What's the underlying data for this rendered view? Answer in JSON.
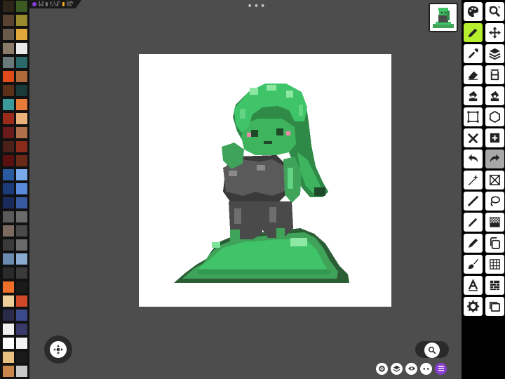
{
  "status": {
    "mem_line1": "4.0",
    "mem_line2": "99%",
    "cpu_line1": "ø 2.45",
    "cpu_line2": "12.5M",
    "bat_line1": "540%",
    "bat_line2": "25%"
  },
  "palette_colors": [
    "#2e2418",
    "#3c5a22",
    "#5a4232",
    "#9a8a2e",
    "#6a5a4a",
    "#e0a83a",
    "#8a7a6a",
    "#eaeaea",
    "#6a7a7a",
    "#2a6a6a",
    "#e04a1a",
    "#b06a3a",
    "#5a3018",
    "#1a3a3a",
    "#3a9a9a",
    "#e87a3a",
    "#9a2a1a",
    "#eab27a",
    "#6a1a1a",
    "#b0704a",
    "#4a2018",
    "#8a2a1a",
    "#5a1010",
    "#6a2a18",
    "#2a5aa0",
    "#7aaaea",
    "#1a3a7a",
    "#5a8ada",
    "#1a2a5a",
    "#3a5aa0",
    "#5a5a5a",
    "#6a6a6a",
    "#7a6a60",
    "#4a4a4a",
    "#3a3a3a",
    "#6a6a6a",
    "#6a8ab0",
    "#8aaad0",
    "#2a2a2a",
    "#3a3a3a",
    "#f0702a",
    "#1a1a1a",
    "#f0d09a",
    "#d04a2a",
    "#2a2a4a",
    "#3a4a8a",
    "#f0f0f0",
    "#3a3a6a",
    "#ffffff",
    "#f4f4f4",
    "#e8c080",
    "#1a1a1a",
    "#c8864a",
    "#c8c8c8"
  ],
  "tools": [
    {
      "name": "palette",
      "active": false
    },
    {
      "name": "zoom",
      "active": false
    },
    {
      "name": "pencil",
      "active": true
    },
    {
      "name": "move",
      "active": false
    },
    {
      "name": "eyedropper",
      "active": false
    },
    {
      "name": "layers",
      "active": false
    },
    {
      "name": "eraser",
      "active": false
    },
    {
      "name": "frames",
      "active": false
    },
    {
      "name": "fill-bucket",
      "active": false
    },
    {
      "name": "fill-bucket-alt",
      "active": false
    },
    {
      "name": "select-rect",
      "active": false
    },
    {
      "name": "select-hex",
      "active": false
    },
    {
      "name": "tools",
      "active": false
    },
    {
      "name": "add-image",
      "active": false
    },
    {
      "name": "undo",
      "active": false
    },
    {
      "name": "redo",
      "active": false
    },
    {
      "name": "magic-wand",
      "active": false
    },
    {
      "name": "transform",
      "active": false
    },
    {
      "name": "line",
      "active": false
    },
    {
      "name": "lasso",
      "active": false
    },
    {
      "name": "pen",
      "active": false
    },
    {
      "name": "dither",
      "active": false
    },
    {
      "name": "brush-pen",
      "active": false
    },
    {
      "name": "copy",
      "active": false
    },
    {
      "name": "paint-brush",
      "active": false
    },
    {
      "name": "grid",
      "active": false
    },
    {
      "name": "text",
      "active": false
    },
    {
      "name": "pattern",
      "active": false
    },
    {
      "name": "settings",
      "active": false
    },
    {
      "name": "windows",
      "active": false
    }
  ],
  "bottom_tray": [
    "settings",
    "layers",
    "preview",
    "more",
    "menu"
  ],
  "icons": {
    "joystick": "move-joystick-icon",
    "zoom": "search-icon",
    "grip": "drag-grip-icon"
  }
}
